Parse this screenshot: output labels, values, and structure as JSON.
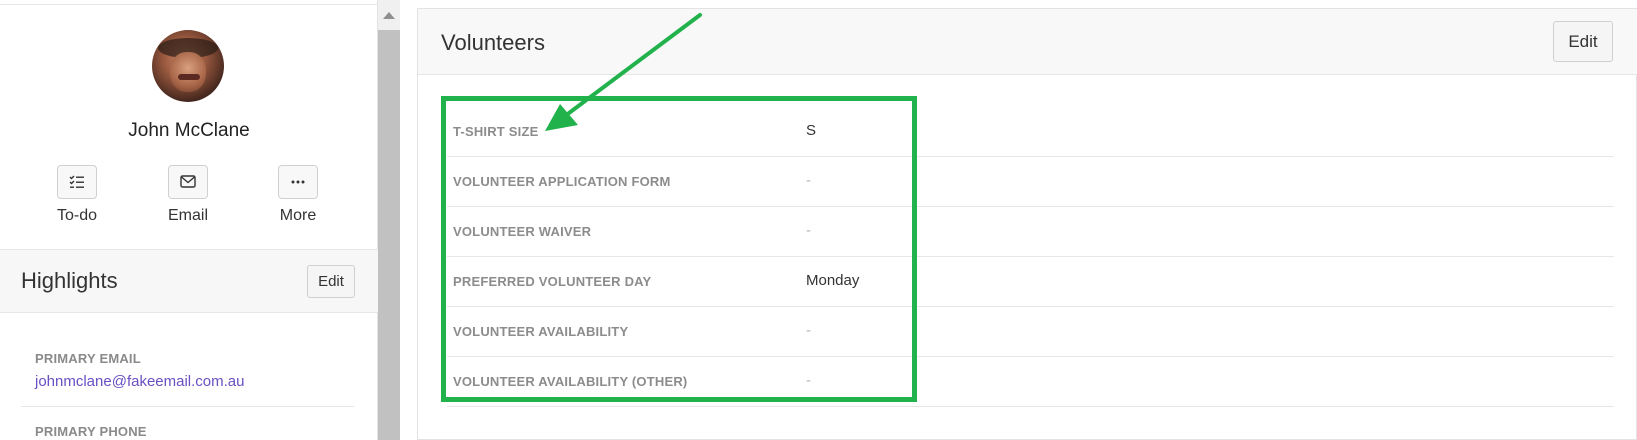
{
  "profile": {
    "name": "John McClane",
    "actions": [
      {
        "label": "To-do",
        "icon": "todo-list-icon"
      },
      {
        "label": "Email",
        "icon": "envelope-icon"
      },
      {
        "label": "More",
        "icon": "ellipsis-icon"
      }
    ]
  },
  "highlights": {
    "title": "Highlights",
    "edit_label": "Edit",
    "fields": [
      {
        "label": "PRIMARY EMAIL",
        "value": "johnmclane@fakeemail.com.au"
      },
      {
        "label": "PRIMARY PHONE",
        "value": ""
      }
    ]
  },
  "volunteers": {
    "title": "Volunteers",
    "edit_label": "Edit",
    "rows": [
      {
        "label": "T-SHIRT SIZE",
        "value": "S"
      },
      {
        "label": "VOLUNTEER APPLICATION FORM",
        "value": "-"
      },
      {
        "label": "VOLUNTEER WAIVER",
        "value": "-"
      },
      {
        "label": "PREFERRED VOLUNTEER DAY",
        "value": "Monday"
      },
      {
        "label": "VOLUNTEER AVAILABILITY",
        "value": "-"
      },
      {
        "label": "VOLUNTEER AVAILABILITY (OTHER)",
        "value": "-"
      }
    ]
  },
  "colors": {
    "link": "#6a4fc2",
    "annotation": "#22b24c"
  }
}
